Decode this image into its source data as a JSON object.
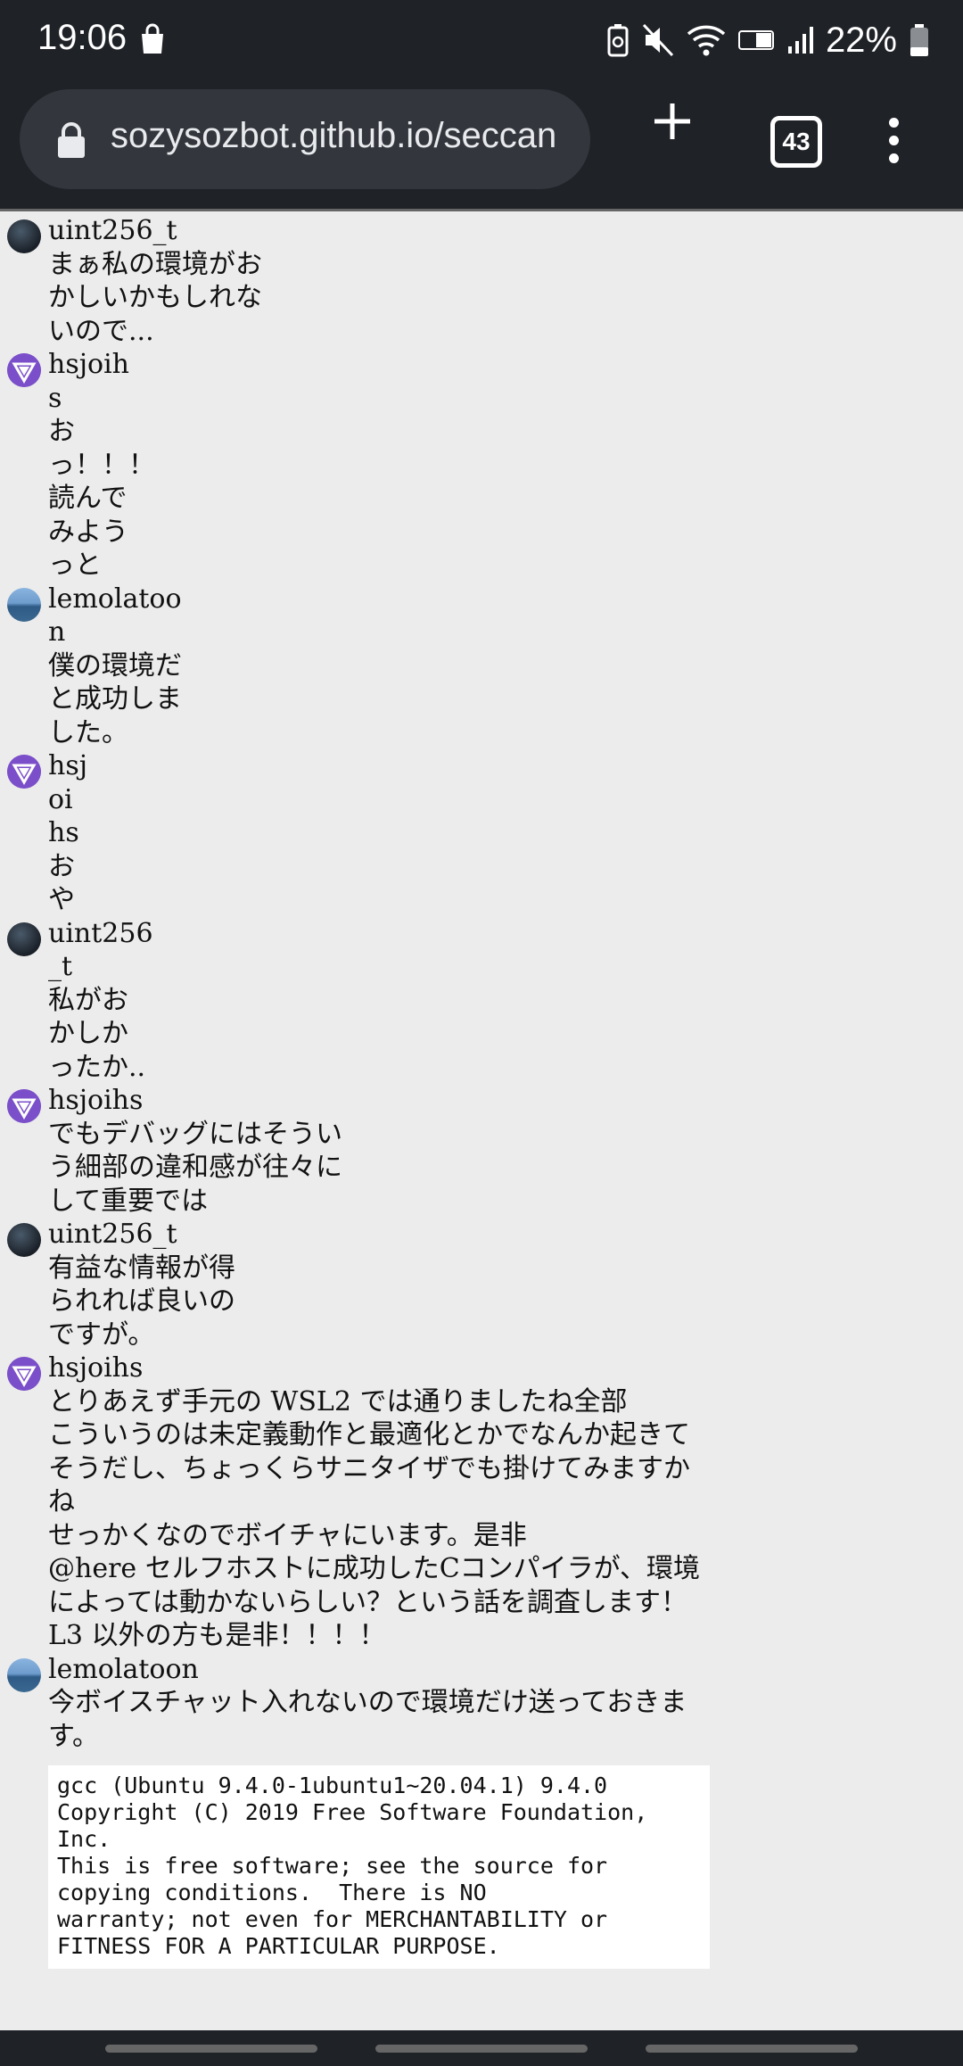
{
  "status": {
    "time": "19:06",
    "battery": "22%"
  },
  "browser": {
    "url": "sozysozbot.github.io/seccan",
    "tab_count": "43"
  },
  "messages": [
    {
      "author": "uint256_t",
      "avatar": "uint",
      "lines": [
        "まぁ私の環境がお",
        "かしいかもしれな",
        "いので..."
      ]
    },
    {
      "author": "hsjoih",
      "avatar": "hsjoihs",
      "lines": [
        "s",
        "お",
        "っ！！！",
        "読んで",
        "みよう",
        "っと"
      ]
    },
    {
      "author": "lemolatoo",
      "avatar": "lemolatoon",
      "lines": [
        "n",
        "僕の環境だ",
        "と成功しま",
        "した。"
      ]
    },
    {
      "author": "hsj",
      "avatar": "hsjoihs",
      "lines": [
        "oi",
        "hs",
        "お",
        "や"
      ]
    },
    {
      "author": "uint256",
      "avatar": "uint",
      "lines": [
        "_t",
        "私がお",
        "かしか",
        "ったか.."
      ]
    },
    {
      "author": "hsjoihs",
      "avatar": "hsjoihs",
      "lines": [
        "でもデバッグにはそうい",
        "う細部の違和感が往々に",
        "して重要では"
      ]
    },
    {
      "author": "uint256_t",
      "avatar": "uint",
      "lines": [
        "有益な情報が得",
        "られれば良いの",
        "ですが。"
      ]
    },
    {
      "author": "hsjoihs",
      "avatar": "hsjoihs",
      "lines": [
        "とりあえず手元の WSL2 では通りましたね全部",
        "こういうのは未定義動作と最適化とかでなんか起きて",
        "そうだし、ちょっくらサニタイザでも掛けてみますか",
        "ね",
        "せっかくなのでボイチャにいます。是非",
        "@here セルフホストに成功したCコンパイラが、環境",
        "によっては動かないらしい？という話を調査します！",
        "L3 以外の方も是非！！！！"
      ]
    },
    {
      "author": "lemolatoon",
      "avatar": "lemolatoon",
      "lines": [
        "今ボイスチャット入れないので環境だけ送っておきま",
        "す。"
      ],
      "code": [
        "gcc (Ubuntu 9.4.0-1ubuntu1~20.04.1) 9.4.0",
        "Copyright (C) 2019 Free Software Foundation,",
        "Inc.",
        "This is free software; see the source for",
        "copying conditions.  There is NO",
        "warranty; not even for MERCHANTABILITY or",
        "FITNESS FOR A PARTICULAR PURPOSE."
      ]
    }
  ]
}
